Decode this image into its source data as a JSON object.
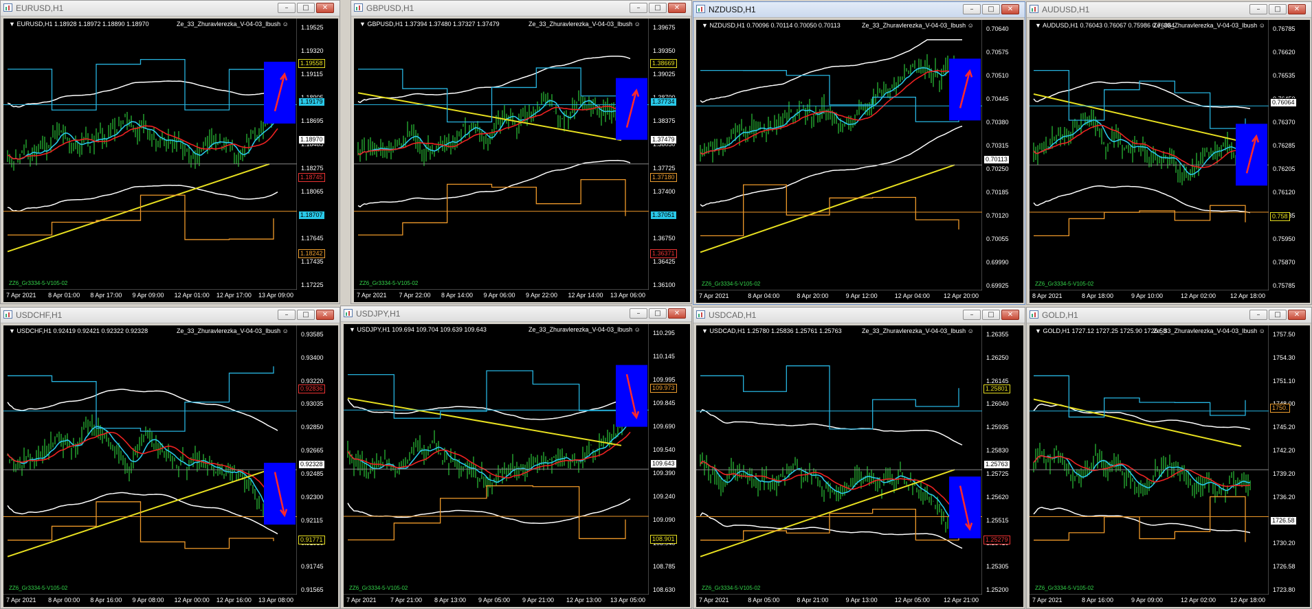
{
  "indicator_name": "Ze_33_Zhuravlerezka_V-04-03_Ibush",
  "footer_label": "ZZ6_Gr3334-5-V105-02",
  "colors": {
    "bull": "#33ee44",
    "ma1": "#29c8e8",
    "ma2": "#ee2222",
    "env": "#ffffff",
    "long": "#e8e020",
    "level": "#f09a2a",
    "chan": "#27b4e0",
    "box": "#0000ff",
    "arrow": "#ff2a2a"
  },
  "windows": [
    {
      "title": "EURUSD,H1",
      "header": "EURUSD,H1  1.18928 1.18972 1.18890 1.18970",
      "active": false,
      "direction": "up",
      "prices": [
        "1.19525",
        "1.19320",
        "1.19115",
        "1.18905",
        "1.18695",
        "1.18485",
        "1.18275",
        "1.18065",
        "1.17855",
        "1.17645",
        "1.17435",
        "1.17225"
      ],
      "times": [
        "7 Apr 2021",
        "8 Apr 01:00",
        "8 Apr 17:00",
        "9 Apr 09:00",
        "12 Apr 01:00",
        "12 Apr 17:00",
        "13 Apr 09:00"
      ],
      "tags": [
        {
          "text": "1.19558",
          "kind": "long"
        },
        {
          "text": "1.19179",
          "kind": "chan"
        },
        {
          "text": "1.18970",
          "kind": "current"
        },
        {
          "text": "1.18745",
          "kind": "red"
        },
        {
          "text": "1.18707",
          "kind": "chan"
        },
        {
          "text": "1.18242",
          "kind": "level"
        }
      ]
    },
    {
      "title": "GBPUSD,H1",
      "header": "GBPUSD,H1  1.37394 1.37480 1.37327 1.37479",
      "active": false,
      "direction": "up",
      "prices": [
        "1.39675",
        "1.39350",
        "1.39025",
        "1.38700",
        "1.38375",
        "1.38050",
        "1.37725",
        "1.37400",
        "1.37075",
        "1.36750",
        "1.36425",
        "1.36100"
      ],
      "times": [
        "7 Apr 2021",
        "7 Apr 22:00",
        "8 Apr 14:00",
        "9 Apr 06:00",
        "9 Apr 22:00",
        "12 Apr 14:00",
        "13 Apr 06:00"
      ],
      "tags": [
        {
          "text": "1.38669",
          "kind": "long"
        },
        {
          "text": "1.37734",
          "kind": "chan"
        },
        {
          "text": "1.37479",
          "kind": "current"
        },
        {
          "text": "1.37180",
          "kind": "level"
        },
        {
          "text": "1.37051",
          "kind": "chan"
        },
        {
          "text": "1.36371",
          "kind": "red"
        }
      ]
    },
    {
      "title": "NZDUSD,H1",
      "header": "NZDUSD,H1  0.70096 0.70114 0.70050 0.70113",
      "active": true,
      "direction": "up",
      "prices": [
        "0.70640",
        "0.70575",
        "0.70510",
        "0.70445",
        "0.70380",
        "0.70315",
        "0.70250",
        "0.70185",
        "0.70120",
        "0.70055",
        "0.69990",
        "0.69925"
      ],
      "times": [
        "7 Apr 2021",
        "8 Apr 04:00",
        "8 Apr 20:00",
        "9 Apr 12:00",
        "12 Apr 04:00",
        "12 Apr 20:00"
      ],
      "tags": [
        {
          "text": "0.70113",
          "kind": "current"
        }
      ]
    },
    {
      "title": "AUDUSD,H1",
      "header": "AUDUSD,H1  0.76043 0.76067 0.75986 0.76064",
      "active": false,
      "direction": "up",
      "prices": [
        "0.76785",
        "0.76620",
        "0.76535",
        "0.76450",
        "0.76370",
        "0.76285",
        "0.76205",
        "0.76120",
        "0.76035",
        "0.75950",
        "0.75870",
        "0.75785"
      ],
      "times": [
        "8 Apr 2021",
        "8 Apr 18:00",
        "9 Apr 10:00",
        "12 Apr 02:00",
        "12 Apr 18:00"
      ],
      "tags": [
        {
          "text": "0.76064",
          "kind": "current"
        },
        {
          "text": "0.758",
          "kind": "long"
        }
      ]
    },
    {
      "title": "USDCHF,H1",
      "header": "USDCHF,H1  0.92419 0.92421 0.92322 0.92328",
      "active": false,
      "direction": "down",
      "prices": [
        "0.93585",
        "0.93400",
        "0.93220",
        "0.93035",
        "0.92850",
        "0.92665",
        "0.92485",
        "0.92300",
        "0.92115",
        "0.91930",
        "0.91745",
        "0.91565"
      ],
      "times": [
        "7 Apr 2021",
        "8 Apr 00:00",
        "8 Apr 16:00",
        "9 Apr 08:00",
        "12 Apr 00:00",
        "12 Apr 16:00",
        "13 Apr 08:00"
      ],
      "tags": [
        {
          "text": "0.92836",
          "kind": "red"
        },
        {
          "text": "0.92328",
          "kind": "current"
        },
        {
          "text": "0.91771",
          "kind": "long"
        }
      ]
    },
    {
      "title": "USDJPY,H1",
      "header": "USDJPY,H1  109.694 109.704 109.639 109.643",
      "active": false,
      "direction": "down",
      "prices": [
        "110.295",
        "110.145",
        "109.995",
        "109.845",
        "109.690",
        "109.540",
        "109.390",
        "109.240",
        "109.090",
        "108.940",
        "108.785",
        "108.630"
      ],
      "times": [
        "7 Apr 2021",
        "7 Apr 21:00",
        "8 Apr 13:00",
        "9 Apr 05:00",
        "9 Apr 21:00",
        "12 Apr 13:00",
        "13 Apr 05:00"
      ],
      "tags": [
        {
          "text": "109.973",
          "kind": "level"
        },
        {
          "text": "109.643",
          "kind": "current"
        },
        {
          "text": "108.901",
          "kind": "long"
        }
      ]
    },
    {
      "title": "USDCAD,H1",
      "header": "USDCAD,H1  1.25780 1.25836 1.25761 1.25763",
      "active": false,
      "direction": "down",
      "prices": [
        "1.26355",
        "1.26250",
        "1.26145",
        "1.26040",
        "1.25935",
        "1.25830",
        "1.25725",
        "1.25620",
        "1.25515",
        "1.25410",
        "1.25305",
        "1.25200"
      ],
      "times": [
        "7 Apr 2021",
        "8 Apr 05:00",
        "8 Apr 21:00",
        "9 Apr 13:00",
        "12 Apr 05:00",
        "12 Apr 21:00"
      ],
      "tags": [
        {
          "text": "1.25801",
          "kind": "long"
        },
        {
          "text": "1.25763",
          "kind": "current"
        },
        {
          "text": "1.25279",
          "kind": "red"
        }
      ]
    },
    {
      "title": "GOLD,H1",
      "header": "GOLD,H1  1727.12 1727.25 1725.90 1726.58",
      "active": false,
      "direction": "none",
      "prices": [
        "1757.50",
        "1754.30",
        "1751.10",
        "1748.00",
        "1745.20",
        "1742.20",
        "1739.20",
        "1736.20",
        "1733.20",
        "1730.20",
        "1726.58",
        "1723.80"
      ],
      "times": [
        "7 Apr 2021",
        "8 Apr 16:00",
        "9 Apr 09:00",
        "12 Apr 02:00",
        "12 Apr 18:00"
      ],
      "tags": [
        {
          "text": "1750.",
          "kind": "level"
        },
        {
          "text": "1726.58",
          "kind": "current"
        }
      ]
    }
  ]
}
